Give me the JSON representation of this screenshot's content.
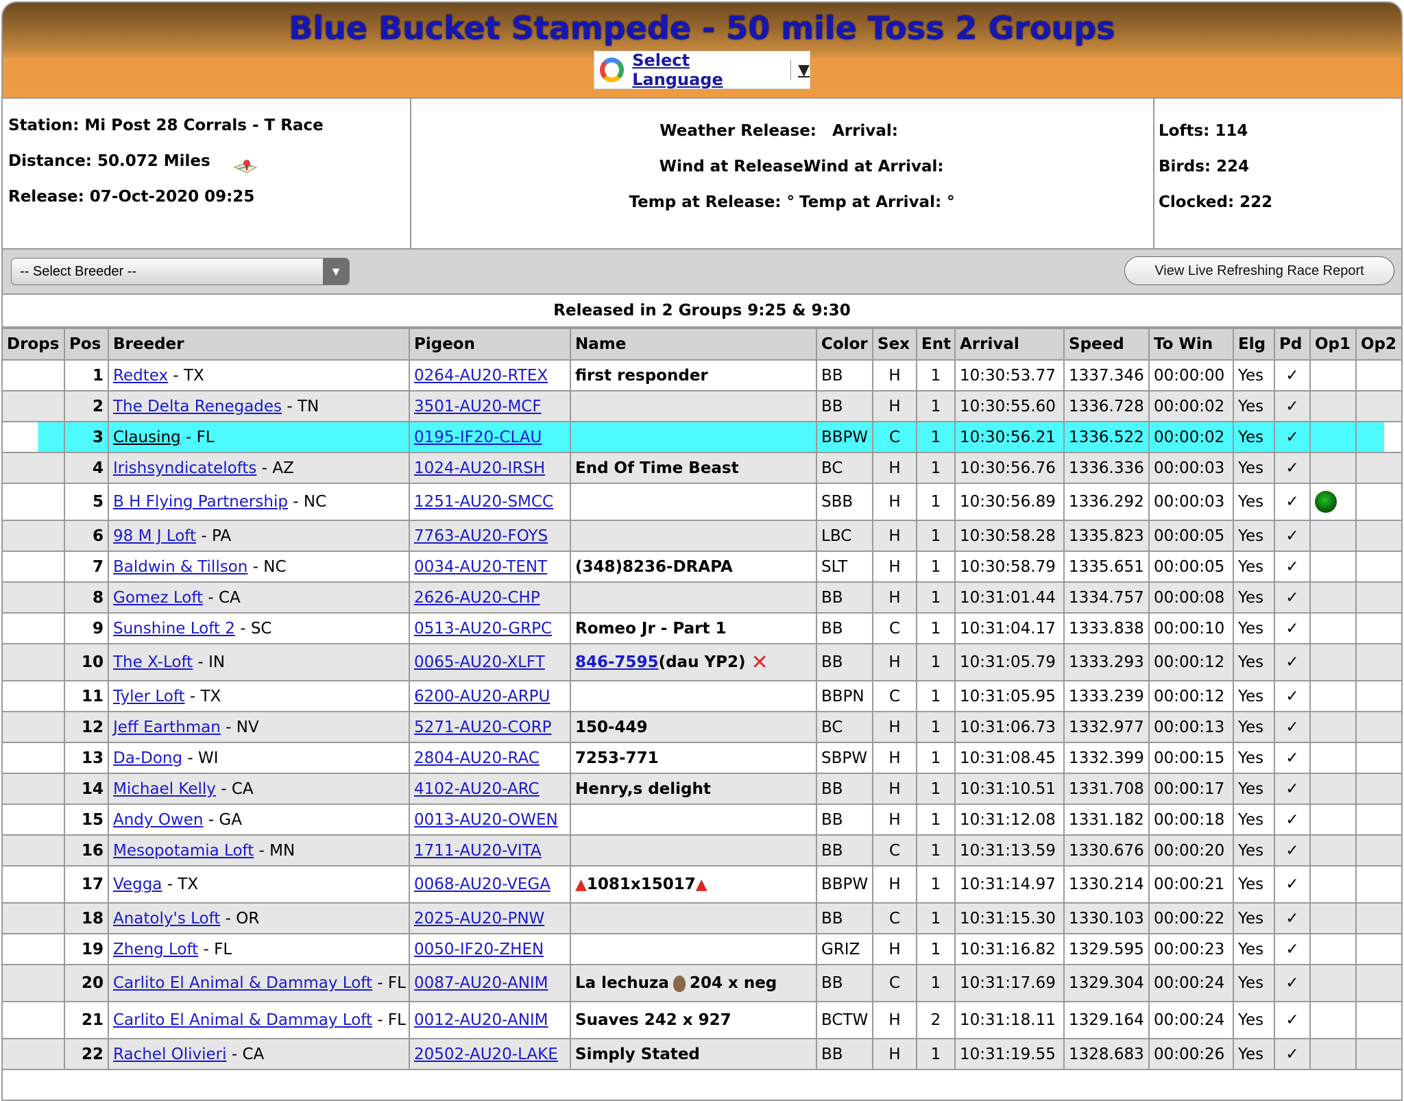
{
  "header": {
    "title": "Blue Bucket Stampede - 50 mile Toss 2 Groups",
    "language_label": "Select Language",
    "language_arrow": "▼"
  },
  "info": {
    "station": "Station: Mi Post 28 Corrals - T Race",
    "distance": "Distance: 50.072 Miles",
    "release": "Release: 07-Oct-2020 09:25",
    "weather_release": "Weather Release:",
    "arrival": "Arrival:",
    "wind_release": "Wind at Release:",
    "wind_arrival": "Wind at Arrival:",
    "temp_release": "Temp at Release: °",
    "temp_arrival": "Temp at Arrival: °",
    "lofts": "Lofts: 114",
    "birds": "Birds: 224",
    "clocked": "Clocked: 222"
  },
  "toolbar": {
    "breeder_select": "-- Select Breeder --",
    "live_report_button": "View Live Refreshing Race Report"
  },
  "released_banner": "Released in 2 Groups 9:25 & 9:30",
  "table": {
    "headers": [
      "Drops",
      "Pos",
      "Breeder",
      "Pigeon",
      "Name",
      "Color",
      "Sex",
      "Ent",
      "Arrival",
      "Speed",
      "To Win",
      "Elg",
      "Pd",
      "Op1",
      "Op2"
    ],
    "rows": [
      {
        "pos": "1",
        "breeder": "Redtex",
        "state": "- TX",
        "pigeon": "0264-AU20-RTEX",
        "name": "first responder",
        "color": "BB",
        "sex": "H",
        "ent": "1",
        "arrival": "10:30:53.77",
        "speed": "1337.346",
        "towin": "00:00:00",
        "elg": "Yes",
        "pd": "✓"
      },
      {
        "pos": "2",
        "breeder": "The Delta Renegades",
        "state": "- TN",
        "pigeon": "3501-AU20-MCF",
        "name": "",
        "color": "BB",
        "sex": "H",
        "ent": "1",
        "arrival": "10:30:55.60",
        "speed": "1336.728",
        "towin": "00:00:02",
        "elg": "Yes",
        "pd": "✓"
      },
      {
        "pos": "3",
        "breeder": "Clausing",
        "state": "- FL",
        "pigeon": "0195-IF20-CLAU",
        "name": "",
        "color": "BBPW",
        "sex": "C",
        "ent": "1",
        "arrival": "10:30:56.21",
        "speed": "1336.522",
        "towin": "00:00:02",
        "elg": "Yes",
        "pd": "✓"
      },
      {
        "pos": "4",
        "breeder": "Irishsyndicatelofts",
        "state": "- AZ",
        "pigeon": "1024-AU20-IRSH",
        "name": "End Of Time Beast",
        "color": "BC",
        "sex": "H",
        "ent": "1",
        "arrival": "10:30:56.76",
        "speed": "1336.336",
        "towin": "00:00:03",
        "elg": "Yes",
        "pd": "✓"
      },
      {
        "pos": "5",
        "breeder": "B H Flying Partnership",
        "state": "- NC",
        "pigeon": "1251-AU20-SMCC",
        "name": "",
        "color": "SBB",
        "sex": "H",
        "ent": "1",
        "arrival": "10:30:56.89",
        "speed": "1336.292",
        "towin": "00:00:03",
        "elg": "Yes",
        "pd": "✓"
      },
      {
        "pos": "6",
        "breeder": "98 M J Loft",
        "state": "- PA",
        "pigeon": "7763-AU20-FOYS",
        "name": "",
        "color": "LBC",
        "sex": "H",
        "ent": "1",
        "arrival": "10:30:58.28",
        "speed": "1335.823",
        "towin": "00:00:05",
        "elg": "Yes",
        "pd": "✓"
      },
      {
        "pos": "7",
        "breeder": "Baldwin & Tillson",
        "state": "- NC",
        "pigeon": "0034-AU20-TENT",
        "name": "(348)8236-DRAPA",
        "color": "SLT",
        "sex": "H",
        "ent": "1",
        "arrival": "10:30:58.79",
        "speed": "1335.651",
        "towin": "00:00:05",
        "elg": "Yes",
        "pd": "✓"
      },
      {
        "pos": "8",
        "breeder": "Gomez Loft",
        "state": "- CA",
        "pigeon": "2626-AU20-CHP",
        "name": "",
        "color": "BB",
        "sex": "H",
        "ent": "1",
        "arrival": "10:31:01.44",
        "speed": "1334.757",
        "towin": "00:00:08",
        "elg": "Yes",
        "pd": "✓"
      },
      {
        "pos": "9",
        "breeder": "Sunshine Loft 2",
        "state": "- SC",
        "pigeon": "0513-AU20-GRPC",
        "name": "Romeo Jr - Part 1",
        "color": "BB",
        "sex": "C",
        "ent": "1",
        "arrival": "10:31:04.17",
        "speed": "1333.838",
        "towin": "00:00:10",
        "elg": "Yes",
        "pd": "✓"
      },
      {
        "pos": "10",
        "breeder": "The X-Loft",
        "state": "- IN",
        "pigeon": "0065-AU20-XLFT",
        "name_link": "846-7595",
        "name_rest": "(dau YP2)",
        "color": "BB",
        "sex": "H",
        "ent": "1",
        "arrival": "10:31:05.79",
        "speed": "1333.293",
        "towin": "00:00:12",
        "elg": "Yes",
        "pd": "✓"
      },
      {
        "pos": "11",
        "breeder": "Tyler Loft",
        "state": "- TX",
        "pigeon": "6200-AU20-ARPU",
        "name": "",
        "color": "BBPN",
        "sex": "C",
        "ent": "1",
        "arrival": "10:31:05.95",
        "speed": "1333.239",
        "towin": "00:00:12",
        "elg": "Yes",
        "pd": "✓"
      },
      {
        "pos": "12",
        "breeder": "Jeff Earthman",
        "state": "- NV",
        "pigeon": "5271-AU20-CORP",
        "name": "150-449",
        "color": "BC",
        "sex": "H",
        "ent": "1",
        "arrival": "10:31:06.73",
        "speed": "1332.977",
        "towin": "00:00:13",
        "elg": "Yes",
        "pd": "✓"
      },
      {
        "pos": "13",
        "breeder": "Da-Dong",
        "state": "- WI",
        "pigeon": "2804-AU20-RAC",
        "name": "7253-771",
        "color": "SBPW",
        "sex": "H",
        "ent": "1",
        "arrival": "10:31:08.45",
        "speed": "1332.399",
        "towin": "00:00:15",
        "elg": "Yes",
        "pd": "✓"
      },
      {
        "pos": "14",
        "breeder": "Michael Kelly",
        "state": "- CA",
        "pigeon": "4102-AU20-ARC",
        "name": "Henry,s delight",
        "color": "BB",
        "sex": "H",
        "ent": "1",
        "arrival": "10:31:10.51",
        "speed": "1331.708",
        "towin": "00:00:17",
        "elg": "Yes",
        "pd": "✓"
      },
      {
        "pos": "15",
        "breeder": "Andy Owen",
        "state": "- GA",
        "pigeon": "0013-AU20-OWEN",
        "name": "",
        "color": "BB",
        "sex": "H",
        "ent": "1",
        "arrival": "10:31:12.08",
        "speed": "1331.182",
        "towin": "00:00:18",
        "elg": "Yes",
        "pd": "✓"
      },
      {
        "pos": "16",
        "breeder": "Mesopotamia Loft",
        "state": "- MN",
        "pigeon": "1711-AU20-VITA",
        "name": "",
        "color": "BB",
        "sex": "C",
        "ent": "1",
        "arrival": "10:31:13.59",
        "speed": "1330.676",
        "towin": "00:00:20",
        "elg": "Yes",
        "pd": "✓"
      },
      {
        "pos": "17",
        "breeder": "Vegga",
        "state": "- TX",
        "pigeon": "0068-AU20-VEGA",
        "name": "1081x15017",
        "color": "BBPW",
        "sex": "H",
        "ent": "1",
        "arrival": "10:31:14.97",
        "speed": "1330.214",
        "towin": "00:00:21",
        "elg": "Yes",
        "pd": "✓"
      },
      {
        "pos": "18",
        "breeder": "Anatoly's Loft",
        "state": "- OR",
        "pigeon": "2025-AU20-PNW",
        "name": "",
        "color": "BB",
        "sex": "C",
        "ent": "1",
        "arrival": "10:31:15.30",
        "speed": "1330.103",
        "towin": "00:00:22",
        "elg": "Yes",
        "pd": "✓"
      },
      {
        "pos": "19",
        "breeder": "Zheng Loft",
        "state": "- FL",
        "pigeon": "0050-IF20-ZHEN",
        "name": "",
        "color": "GRIZ",
        "sex": "H",
        "ent": "1",
        "arrival": "10:31:16.82",
        "speed": "1329.595",
        "towin": "00:00:23",
        "elg": "Yes",
        "pd": "✓"
      },
      {
        "pos": "20",
        "breeder": "Carlito El Animal & Dammay Loft",
        "state": "- FL",
        "pigeon": "0087-AU20-ANIM",
        "name_a": "La lechuza",
        "name_b": "204 x neg",
        "color": "BB",
        "sex": "C",
        "ent": "1",
        "arrival": "10:31:17.69",
        "speed": "1329.304",
        "towin": "00:00:24",
        "elg": "Yes",
        "pd": "✓"
      },
      {
        "pos": "21",
        "breeder": "Carlito El Animal & Dammay Loft",
        "state": "- FL",
        "pigeon": "0012-AU20-ANIM",
        "name": "Suaves 242 x 927",
        "color": "BCTW",
        "sex": "H",
        "ent": "2",
        "arrival": "10:31:18.11",
        "speed": "1329.164",
        "towin": "00:00:24",
        "elg": "Yes",
        "pd": "✓"
      },
      {
        "pos": "22",
        "breeder": "Rachel Olivieri",
        "state": "- CA",
        "pigeon": "20502-AU20-LAKE",
        "name": "Simply Stated",
        "color": "BB",
        "sex": "H",
        "ent": "1",
        "arrival": "10:31:19.55",
        "speed": "1328.683",
        "towin": "00:00:26",
        "elg": "Yes",
        "pd": "✓"
      }
    ]
  },
  "colors": {
    "header_orange": "#ee9c43",
    "title_blue": "#1616b0",
    "highlight_row": "#4dfbff",
    "link_blue": "#1a1ad0"
  }
}
